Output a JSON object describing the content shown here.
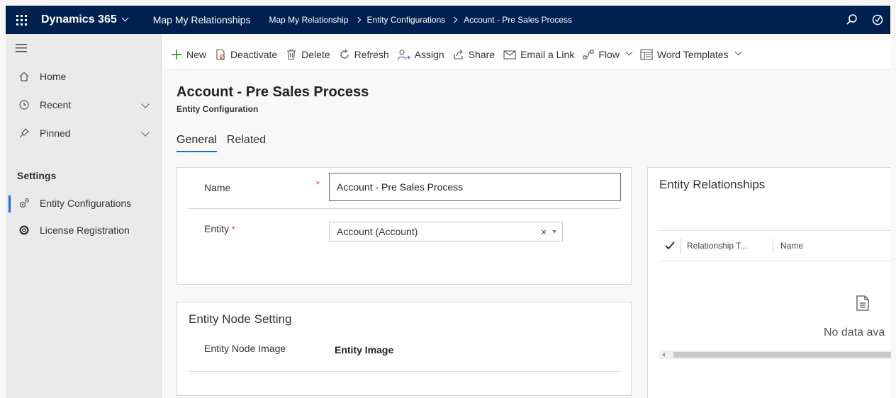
{
  "topbar": {
    "brand": "Dynamics 365",
    "app_name": "Map My Relationships",
    "breadcrumbs": [
      "Map My Relationship",
      "Entity Configurations",
      "Account - Pre Sales Process"
    ],
    "icons": [
      "search-icon",
      "assistant-icon"
    ]
  },
  "sidebar": {
    "items": [
      {
        "label": "Home",
        "icon": "home-icon"
      },
      {
        "label": "Recent",
        "icon": "clock-icon"
      },
      {
        "label": "Pinned",
        "icon": "pin-icon"
      }
    ],
    "section": "Settings",
    "sub_items": [
      {
        "label": "Entity Configurations",
        "icon": "gears-icon",
        "selected": true
      },
      {
        "label": "License Registration",
        "icon": "license-icon"
      }
    ]
  },
  "commands": {
    "new": "New",
    "deactivate": "Deactivate",
    "delete": "Delete",
    "refresh": "Refresh",
    "assign": "Assign",
    "share": "Share",
    "email_link": "Email a Link",
    "flow": "Flow",
    "word_templates": "Word Templates"
  },
  "record": {
    "title": "Account - Pre Sales Process",
    "subtitle": "Entity Configuration"
  },
  "tabs": [
    {
      "label": "General",
      "active": true
    },
    {
      "label": "Related",
      "active": false
    }
  ],
  "general": {
    "name_label": "Name",
    "name_required": "*",
    "name_value": "Account - Pre Sales Process",
    "entity_label": "Entity",
    "entity_required": "*",
    "entity_value": "Account (Account)",
    "clear_glyph": "×"
  },
  "node_setting": {
    "title": "Entity Node Setting",
    "image_label": "Entity Node Image",
    "image_value": "Entity Image"
  },
  "relationships": {
    "title": "Entity Relationships",
    "columns": [
      "Relationship T...",
      "Name"
    ],
    "empty_text": "No data ava"
  },
  "colors": {
    "topbar": "#002050",
    "accent": "#2266e3",
    "required": "#d13438",
    "new_icon": "#107c10"
  }
}
